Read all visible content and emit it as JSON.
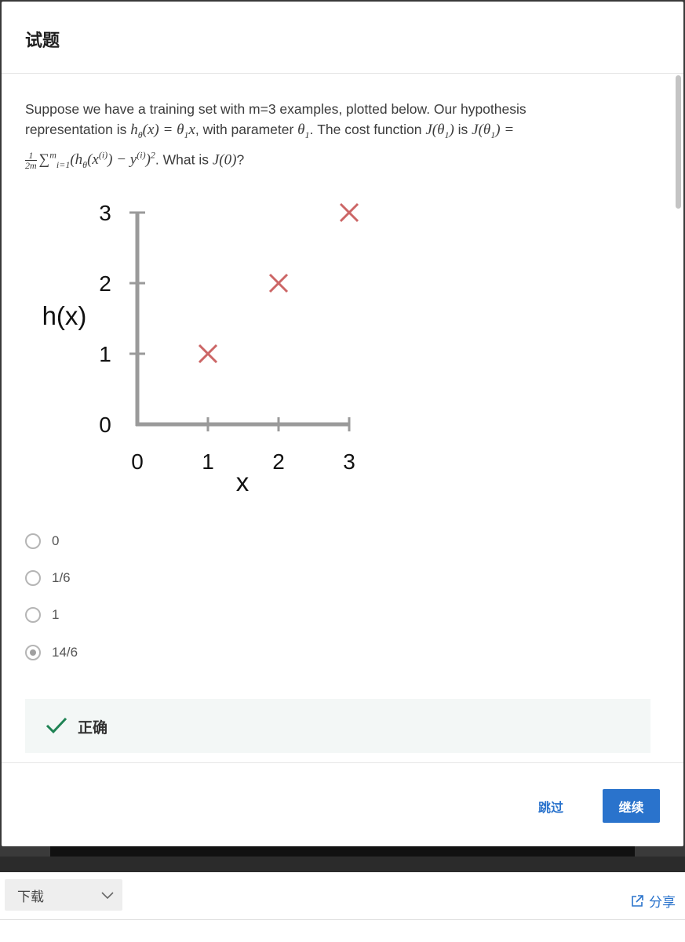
{
  "modal": {
    "title": "试题",
    "question": {
      "part1": "Suppose we have a training set with m=3 examples, plotted below.  Our hypothesis representation is ",
      "hypothesis_math": "hθ(x) = θ1x",
      "part2": ", with parameter ",
      "param_math": "θ1",
      "part3": ". The cost function ",
      "cost_math": "J(θ1)",
      "part4": " is ",
      "cost_def_math": "J(θ1) =",
      "sum_math": "1/2m ∑_{i=1}^{m} (hθ(x^(i)) − y^(i))^2",
      "part5": ". What is ",
      "what_math": "J(0)",
      "part6": "?"
    },
    "plot": {
      "chart_data": {
        "type": "scatter",
        "xlabel": "x",
        "ylabel": "h(x)",
        "x_ticks": [
          "0",
          "1",
          "2",
          "3"
        ],
        "y_ticks": [
          "0",
          "1",
          "2",
          "3"
        ],
        "xlim": [
          0,
          3
        ],
        "ylim": [
          0,
          3
        ],
        "series": [
          {
            "marker": "x",
            "color": "#cc6666",
            "points": [
              [
                1,
                1
              ],
              [
                2,
                2
              ],
              [
                3,
                3
              ]
            ]
          }
        ]
      }
    },
    "options": [
      {
        "label": "0",
        "selected": false
      },
      {
        "label": "1/6",
        "selected": false
      },
      {
        "label": "1",
        "selected": false
      },
      {
        "label": "14/6",
        "selected": true
      }
    ],
    "feedback": {
      "text": "正确",
      "icon": "checkmark-icon",
      "color": "#1f8354"
    },
    "footer": {
      "skip_label": "跳过",
      "continue_label": "继续",
      "accent": "#2a73cc"
    }
  },
  "bottom_bar": {
    "download_label": "下载",
    "share_label": "分享"
  }
}
